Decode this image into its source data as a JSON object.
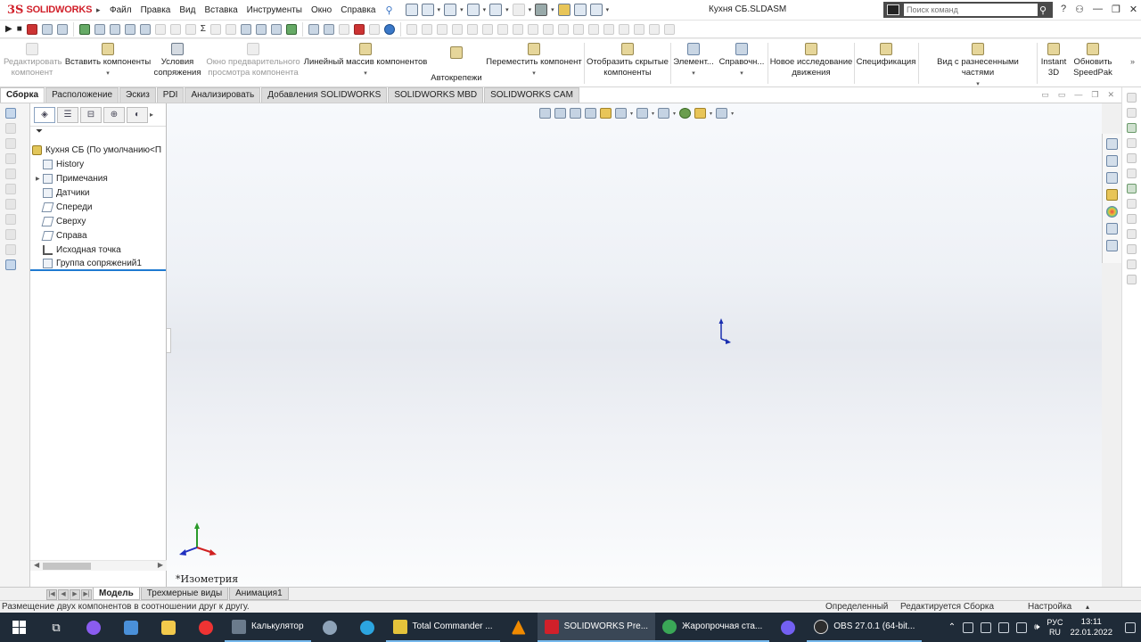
{
  "app": {
    "brand_ds": "3S",
    "brand_name": "SOLIDWORKS",
    "document_title": "Кухня СБ.SLDASM",
    "menus": [
      "Файл",
      "Правка",
      "Вид",
      "Вставка",
      "Инструменты",
      "Окно",
      "Справка"
    ],
    "search_placeholder": "Поиск команд"
  },
  "ribbon": {
    "buttons": [
      {
        "label": "Редактировать компонент",
        "enabled": false
      },
      {
        "label": "Вставить компоненты",
        "enabled": true
      },
      {
        "label": "Условия сопряжения",
        "enabled": true
      },
      {
        "label": "Окно предварительного просмотра компонента",
        "enabled": false
      },
      {
        "label": "Линейный массив компонентов",
        "enabled": true
      },
      {
        "label": "Автокрепежи",
        "enabled": true
      },
      {
        "label": "Переместить компонент",
        "enabled": true
      },
      {
        "label": "Отобразить скрытые компоненты",
        "enabled": true
      },
      {
        "label": "Элемент...",
        "enabled": true
      },
      {
        "label": "Справочн...",
        "enabled": true
      },
      {
        "label": "Новое исследование движения",
        "enabled": true
      },
      {
        "label": "Спецификация",
        "enabled": true
      },
      {
        "label": "Вид с разнесенными частями",
        "enabled": true
      },
      {
        "label": "Instant 3D",
        "enabled": true
      },
      {
        "label": "Обновить SpeedPak",
        "enabled": true
      }
    ]
  },
  "tabs": [
    {
      "label": "Сборка",
      "active": true
    },
    {
      "label": "Расположение",
      "active": false
    },
    {
      "label": "Эскиз",
      "active": false
    },
    {
      "label": "PDI",
      "active": false
    },
    {
      "label": "Анализировать",
      "active": false
    },
    {
      "label": "Добавления SOLIDWORKS",
      "active": false
    },
    {
      "label": "SOLIDWORKS MBD",
      "active": false
    },
    {
      "label": "SOLIDWORKS CAM",
      "active": false
    }
  ],
  "feature_tree": {
    "root": "Кухня СБ  (По умолчанию<П",
    "items": [
      {
        "label": "History",
        "icon": "history-icon",
        "expandable": false
      },
      {
        "label": "Примечания",
        "icon": "annotations-icon",
        "expandable": true
      },
      {
        "label": "Датчики",
        "icon": "sensors-icon",
        "expandable": false
      },
      {
        "label": "Спереди",
        "icon": "plane-icon",
        "expandable": false
      },
      {
        "label": "Сверху",
        "icon": "plane-icon",
        "expandable": false
      },
      {
        "label": "Справа",
        "icon": "plane-icon",
        "expandable": false
      },
      {
        "label": "Исходная точка",
        "icon": "origin-icon",
        "expandable": false
      },
      {
        "label": "Группа сопряжений1",
        "icon": "mates-icon",
        "expandable": false
      }
    ]
  },
  "graphics": {
    "view_name": "*Изометрия"
  },
  "model_tabs": [
    {
      "label": "Модель",
      "active": true
    },
    {
      "label": "Трехмерные виды",
      "active": false
    },
    {
      "label": "Анимация1",
      "active": false
    }
  ],
  "status": {
    "message": "Размещение двух компонентов в соотношении друг к другу.",
    "state": "Определенный",
    "editing": "Редактируется Сборка",
    "settings": "Настройка"
  },
  "taskbar": {
    "apps": [
      {
        "label": "Калькулятор",
        "color": "#6b7b8c",
        "active": false
      },
      {
        "label": "Total Commander ...",
        "color": "#e4c33b",
        "active": false
      },
      {
        "label": "SOLIDWORKS Pre...",
        "color": "#d1202a",
        "active": true
      },
      {
        "label": "Жаропрочная ста...",
        "color": "#3aa757",
        "active": false
      },
      {
        "label": "OBS 27.0.1 (64-bit...",
        "color": "#2d2d2d",
        "active": false
      }
    ],
    "lang_top": "РУС",
    "lang_bottom": "RU",
    "time": "13:11",
    "date": "22.01.2022"
  },
  "colors": {
    "brand_red": "#d1202a",
    "selection_blue": "#1f7ad1",
    "taskbar_bg": "#1f2b38"
  }
}
